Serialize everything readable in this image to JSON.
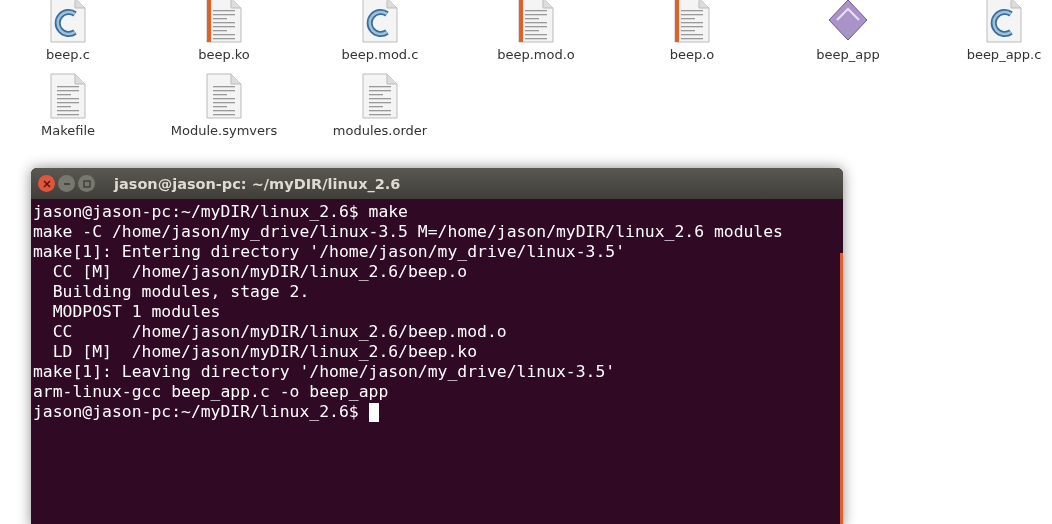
{
  "files": [
    {
      "name": "beep.c",
      "kind": "c"
    },
    {
      "name": "beep.ko",
      "kind": "package"
    },
    {
      "name": "beep.mod.c",
      "kind": "c"
    },
    {
      "name": "beep.mod.o",
      "kind": "package"
    },
    {
      "name": "beep.o",
      "kind": "package"
    },
    {
      "name": "beep_app",
      "kind": "exec"
    },
    {
      "name": "beep_app.c",
      "kind": "c"
    },
    {
      "name": "Makefile",
      "kind": "text"
    },
    {
      "name": "Module.symvers",
      "kind": "text"
    },
    {
      "name": "modules.order",
      "kind": "text"
    }
  ],
  "terminal": {
    "title": "jason@jason-pc: ~/myDIR/linux_2.6",
    "cursor_visible": true,
    "lines": [
      "jason@jason-pc:~/myDIR/linux_2.6$ make",
      "make -C /home/jason/my_drive/linux-3.5 M=/home/jason/myDIR/linux_2.6 modules",
      "make[1]: Entering directory '/home/jason/my_drive/linux-3.5'",
      "  CC [M]  /home/jason/myDIR/linux_2.6/beep.o",
      "  Building modules, stage 2.",
      "  MODPOST 1 modules",
      "  CC      /home/jason/myDIR/linux_2.6/beep.mod.o",
      "  LD [M]  /home/jason/myDIR/linux_2.6/beep.ko",
      "make[1]: Leaving directory '/home/jason/my_drive/linux-3.5'",
      "arm-linux-gcc beep_app.c -o beep_app",
      "jason@jason-pc:~/myDIR/linux_2.6$ "
    ]
  }
}
